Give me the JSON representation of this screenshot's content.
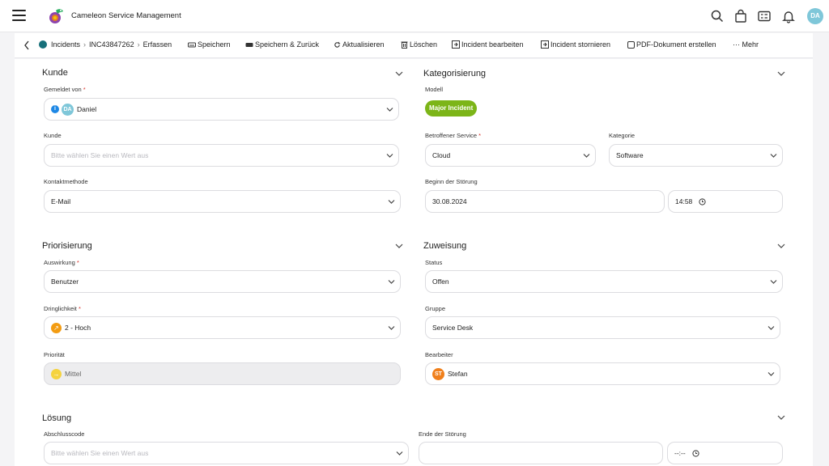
{
  "app": {
    "title": "Cameleon Service Management",
    "user_initials": "DA"
  },
  "toolbar": {
    "breadcrumb_root": "Incidents",
    "breadcrumb_id": "INC43847262",
    "breadcrumb_action": "Erfassen",
    "save": "Speichern",
    "save_back": "Speichern & Zurück",
    "refresh": "Aktualisieren",
    "delete": "Löschen",
    "edit": "Incident bearbeiten",
    "cancel": "Incident stornieren",
    "pdf": "PDF-Dokument erstellen",
    "more": "··· Mehr"
  },
  "kunde": {
    "title": "Kunde",
    "reported_by_label": "Gemeldet von",
    "reported_by_initials": "DA",
    "reported_by_value": "Daniel",
    "customer_label": "Kunde",
    "customer_placeholder": "Bitte wählen Sie einen Wert aus",
    "contact_label": "Kontaktmethode",
    "contact_value": "E-Mail"
  },
  "kategorisierung": {
    "title": "Kategorisierung",
    "model_label": "Modell",
    "model_value": "Major Incident",
    "service_label": "Betroffener Service",
    "service_value": "Cloud",
    "category_label": "Kategorie",
    "category_value": "Software",
    "start_label": "Beginn der Störung",
    "start_date": "30.08.2024",
    "start_time": "14:58"
  },
  "priorisierung": {
    "title": "Priorisierung",
    "impact_label": "Auswirkung",
    "impact_value": "Benutzer",
    "urgency_label": "Dringlichkeit",
    "urgency_value": "2 - Hoch",
    "priority_label": "Priorität",
    "priority_value": "Mittel"
  },
  "zuweisung": {
    "title": "Zuweisung",
    "status_label": "Status",
    "status_value": "Offen",
    "group_label": "Gruppe",
    "group_value": "Service Desk",
    "assignee_label": "Bearbeiter",
    "assignee_initials": "ST",
    "assignee_value": "Stefan"
  },
  "loesung": {
    "title": "Lösung",
    "code_label": "Abschlusscode",
    "code_placeholder": "Bitte wählen Sie einen Wert aus",
    "end_label": "Ende der Störung",
    "end_time_placeholder": "--:--"
  },
  "colors": {
    "accent": "#17707a",
    "badge": "#7cb518",
    "avatar_da": "#7fc7d9",
    "avatar_st": "#f07f1b",
    "required": "#d9342b"
  }
}
